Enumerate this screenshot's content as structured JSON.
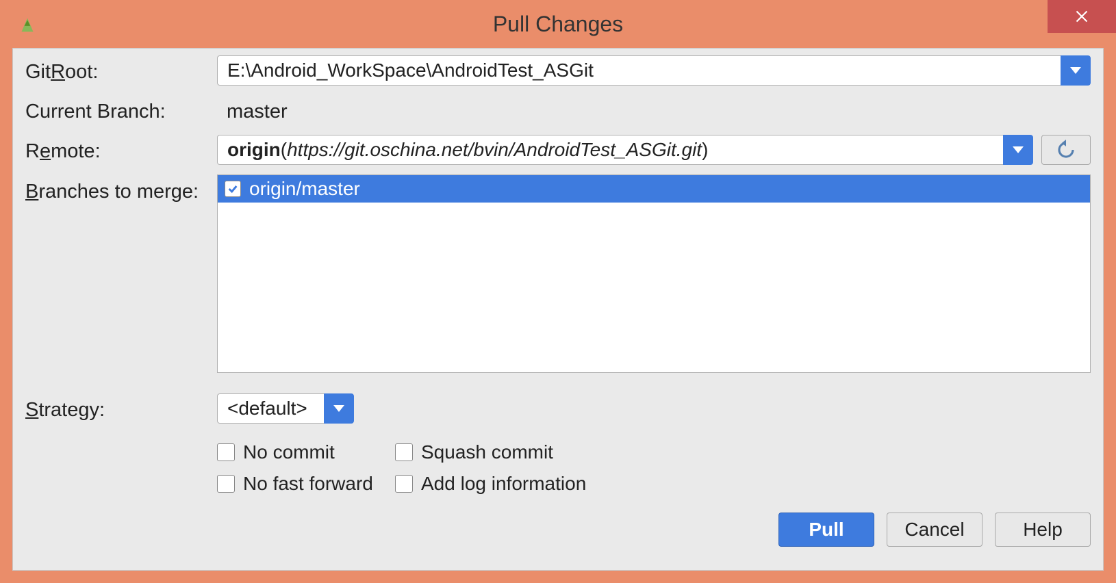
{
  "title": "Pull Changes",
  "labels": {
    "git_root_pre": "Git ",
    "git_root_u": "R",
    "git_root_post": "oot:",
    "current_branch": "Current Branch:",
    "remote_pre": "R",
    "remote_u": "e",
    "remote_post": "mote:",
    "branches_u": "B",
    "branches_post": "ranches to merge:",
    "strategy_u": "S",
    "strategy_post": "trategy:"
  },
  "git_root": "E:\\Android_WorkSpace\\AndroidTest_ASGit",
  "current_branch": "master",
  "remote": {
    "name": "origin",
    "url": "https://git.oschina.net/bvin/AndroidTest_ASGit.git"
  },
  "branches": [
    {
      "name": "origin/master",
      "checked": true,
      "selected": true
    }
  ],
  "strategy": "<default>",
  "checkboxes": {
    "no_commit_pre": "No ",
    "no_commit_u": "c",
    "no_commit_post": "ommit",
    "squash": "Squash commit",
    "no_ff_pre": "No ",
    "no_ff_u": "f",
    "no_ff_post": "ast forward",
    "add_log_pre": "Add ",
    "add_log_u": "l",
    "add_log_post": "og information"
  },
  "buttons": {
    "pull": "Pull",
    "cancel": "Cancel",
    "help": "Help"
  }
}
